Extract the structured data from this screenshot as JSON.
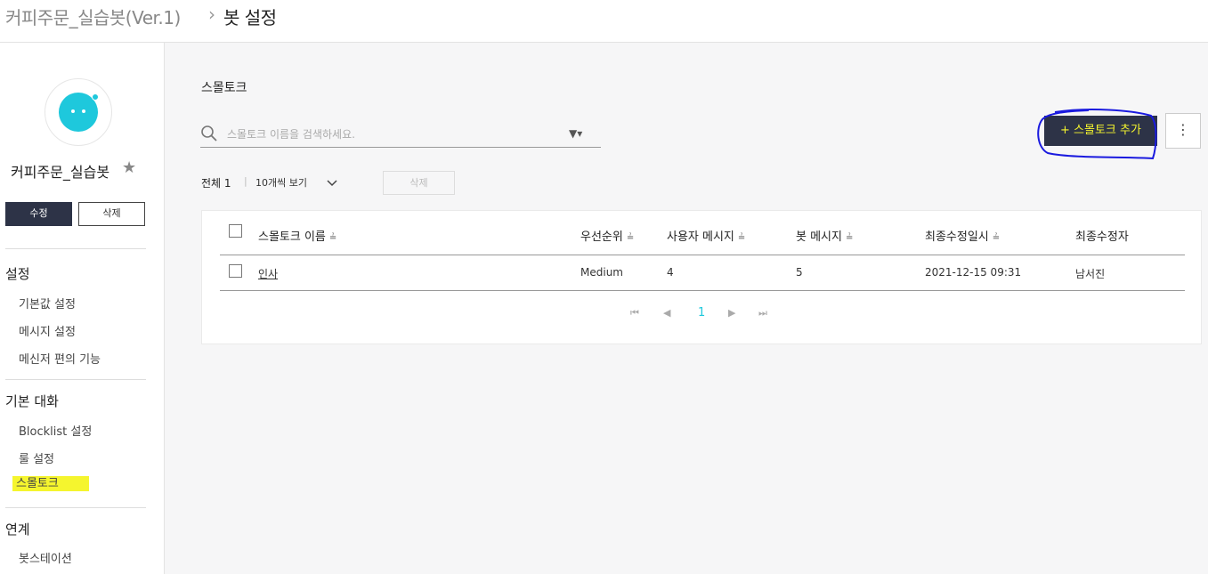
{
  "breadcrumb": {
    "bot": "커피주문_실습봇(Ver.1)",
    "separator": "›",
    "current": "봇 설정"
  },
  "sidebar": {
    "bot_name": "커피주문_실습봇",
    "edit_label": "수정",
    "delete_label": "삭제",
    "sections": [
      {
        "title": "설정",
        "items": [
          "기본값 설정",
          "메시지 설정",
          "메신저 편의 기능"
        ]
      },
      {
        "title": "기본 대화",
        "items": [
          "Blocklist 설정",
          "룰 설정",
          "스몰토크"
        ]
      },
      {
        "title": "연계",
        "items": [
          "봇스테이션"
        ]
      }
    ],
    "active_item": "스몰토크"
  },
  "main": {
    "title": "스몰토크",
    "search_placeholder": "스몰토크 이름을 검색하세요.",
    "total_label": "전체 1",
    "total_sep": "|",
    "per_page": "10개씩 보기",
    "delete_label": "삭제",
    "add_label": "+ 스몰토크 추가",
    "more_label": "⋮"
  },
  "table": {
    "headers": [
      "스몰토크 이름",
      "우선순위",
      "사용자 메시지",
      "봇 메시지",
      "최종수정일시",
      "최종수정자"
    ],
    "rows": [
      {
        "name": "인사",
        "priority": "Medium",
        "user_msgs": "4",
        "bot_msgs": "5",
        "modified": "2021-12-15 09:31",
        "modifier": "남서진"
      }
    ]
  },
  "pagination": {
    "first": "⏮",
    "prev": "◀",
    "current": "1",
    "next": "▶",
    "last": "⏭"
  },
  "colors": {
    "accent": "#1ec8dc",
    "dark_button": "#2d3347",
    "highlight": "#f5f52e",
    "annotation": "#1a1adf"
  }
}
